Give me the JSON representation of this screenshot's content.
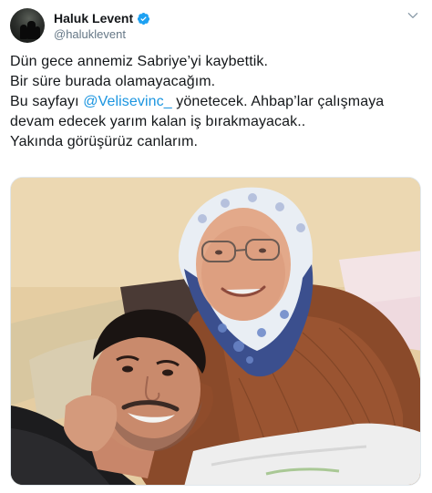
{
  "author": {
    "display_name": "Haluk Levent",
    "handle": "@haluklevent",
    "verified": true,
    "avatar_icon": "profile-avatar-icon"
  },
  "tweet": {
    "line1": "Dün gece annemiz Sabriye’yi kaybettik.",
    "line2": "Bir süre burada olamayacağım.",
    "line3_prefix": "Bu sayfayı ",
    "line3_mention": "@Velisevinc_",
    "line3_suffix": " yönetecek. Ahbap’lar çalışmaya",
    "line4": "devam edecek yarım kalan iş bırakmayacak..",
    "line5": "Yakında görüşürüz canlarım."
  },
  "media": {
    "description_icon": "photo"
  },
  "colors": {
    "accent": "#1b95e0",
    "text": "#14171a",
    "muted": "#657786"
  }
}
